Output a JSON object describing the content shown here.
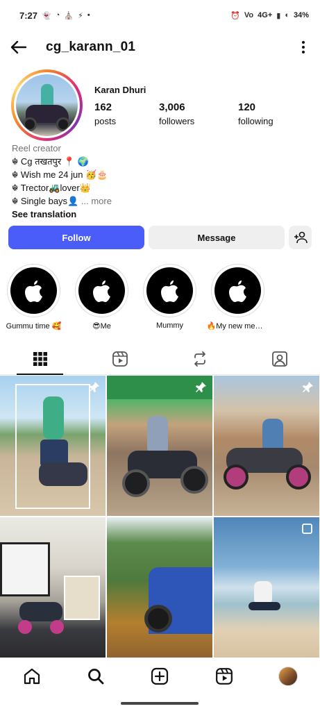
{
  "status_bar": {
    "time": "7:27",
    "network": "4G+",
    "battery": "34%"
  },
  "header": {
    "username": "cg_karann_01"
  },
  "profile": {
    "display_name": "Karan Dhuri",
    "stats": [
      {
        "value": "162",
        "label": "posts"
      },
      {
        "value": "3,006",
        "label": "followers"
      },
      {
        "value": "120",
        "label": "following"
      }
    ],
    "category": "Reel creator",
    "bio_lines": [
      "☬ Cg तखतपुर 📍 🌍",
      "☬ Wish me 24 jun 🥳🎂",
      "☬ Trector🚜lover👑",
      "☬ Single bays👤"
    ],
    "more_label": "... more",
    "see_translation": "See translation"
  },
  "actions": {
    "follow_label": "Follow",
    "message_label": "Message"
  },
  "highlights": [
    {
      "label": "Gummu time 🥰"
    },
    {
      "label": "😎Me"
    },
    {
      "label": "Mummy"
    },
    {
      "label": "🔥My new memb..."
    }
  ],
  "tabs": [
    "grid-icon",
    "reels-icon",
    "reposts-icon",
    "tagged-icon"
  ],
  "grid_posts": [
    {
      "badge": "pin-icon"
    },
    {
      "badge": "pin-icon"
    },
    {
      "badge": "pin-icon"
    },
    {
      "badge": "none"
    },
    {
      "badge": "none"
    },
    {
      "badge": "carousel-icon"
    }
  ],
  "colors": {
    "follow_button": "#4a5df9",
    "secondary_button": "#efefef",
    "muted_text": "#737373"
  }
}
